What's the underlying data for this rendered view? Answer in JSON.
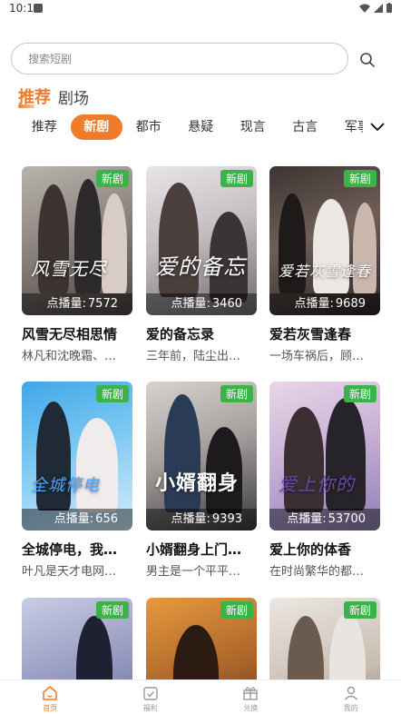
{
  "status_bar": {
    "time": "10:19"
  },
  "search": {
    "placeholder": "搜索短剧"
  },
  "top_tabs": [
    {
      "label": "推荐",
      "active": true
    },
    {
      "label": "剧场",
      "active": false
    }
  ],
  "categories": [
    {
      "label": "推荐",
      "active": false
    },
    {
      "label": "新剧",
      "active": true
    },
    {
      "label": "都市",
      "active": false
    },
    {
      "label": "悬疑",
      "active": false
    },
    {
      "label": "现言",
      "active": false
    },
    {
      "label": "古言",
      "active": false
    },
    {
      "label": "军事",
      "active": false
    }
  ],
  "views_label": "点播量:",
  "dramas": [
    {
      "title": "风雪无尽相思情",
      "desc": "林凡和沈晚霜、…",
      "badge": "新剧",
      "views": "7572",
      "art_title": "风雪无尽"
    },
    {
      "title": "爱的备忘录",
      "desc": "三年前，陆尘出…",
      "badge": "新剧",
      "views": "3460",
      "art_title": "爱的备忘"
    },
    {
      "title": "爱若灰雪逢春",
      "desc": "一场车祸后，顾…",
      "badge": "新剧",
      "views": "9689",
      "art_title": "爱若灰雪逢春"
    },
    {
      "title": "全城停电，我…",
      "desc": "叶凡是天才电网…",
      "badge": "新剧",
      "views": "656",
      "art_title": "全城停电"
    },
    {
      "title": "小婿翻身上门…",
      "desc": "男主是一个平平…",
      "badge": "新剧",
      "views": "9393",
      "art_title": "小婿翻身"
    },
    {
      "title": "爱上你的体香",
      "desc": "在时尚繁华的都…",
      "badge": "新剧",
      "views": "53700",
      "art_title": "爱上你的"
    },
    {
      "title": "",
      "desc": "",
      "badge": "新剧",
      "views": "",
      "art_title": ""
    },
    {
      "title": "",
      "desc": "",
      "badge": "新剧",
      "views": "",
      "art_title": ""
    },
    {
      "title": "",
      "desc": "",
      "badge": "新剧",
      "views": "",
      "art_title": ""
    }
  ],
  "bottom_nav": [
    {
      "label": "首页",
      "icon": "home-icon",
      "active": true
    },
    {
      "label": "福利",
      "icon": "calendar-check-icon",
      "active": false
    },
    {
      "label": "兑换",
      "icon": "gift-icon",
      "active": false
    },
    {
      "label": "我的",
      "icon": "user-icon",
      "active": false
    }
  ],
  "colors": {
    "accent": "#ef7c2a",
    "badge": "#3cb34a"
  }
}
